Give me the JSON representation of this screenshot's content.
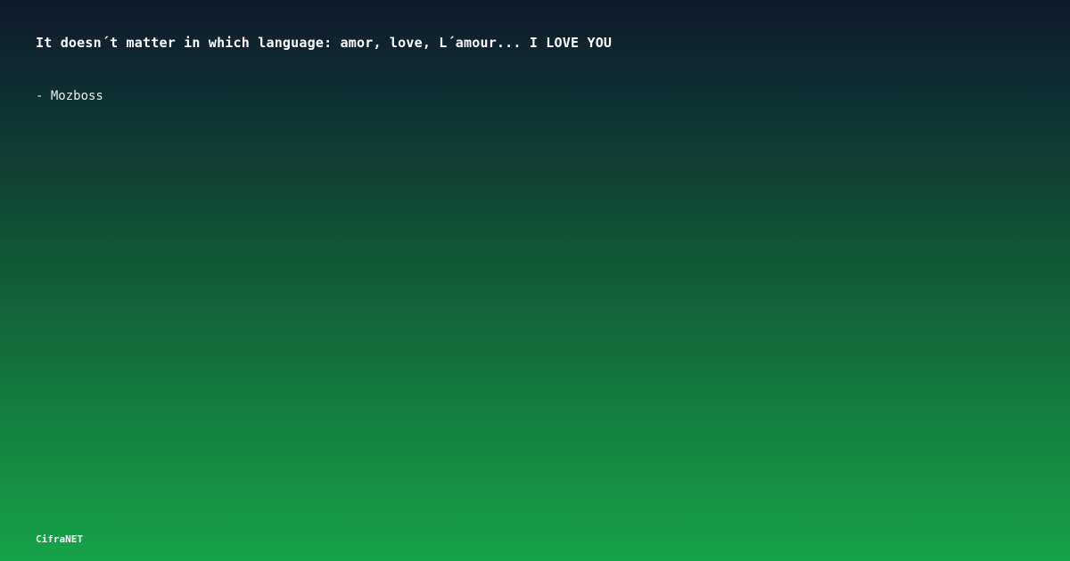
{
  "quote": {
    "text": "It doesn´t matter in which language: amor, love, L´amour... I LOVE YOU",
    "author": "- Mozboss"
  },
  "brand": {
    "name": "CifraNET"
  },
  "colors": {
    "gradient_top": "#0d1a2d",
    "gradient_bottom": "#16a34a",
    "text": "#ffffff"
  }
}
